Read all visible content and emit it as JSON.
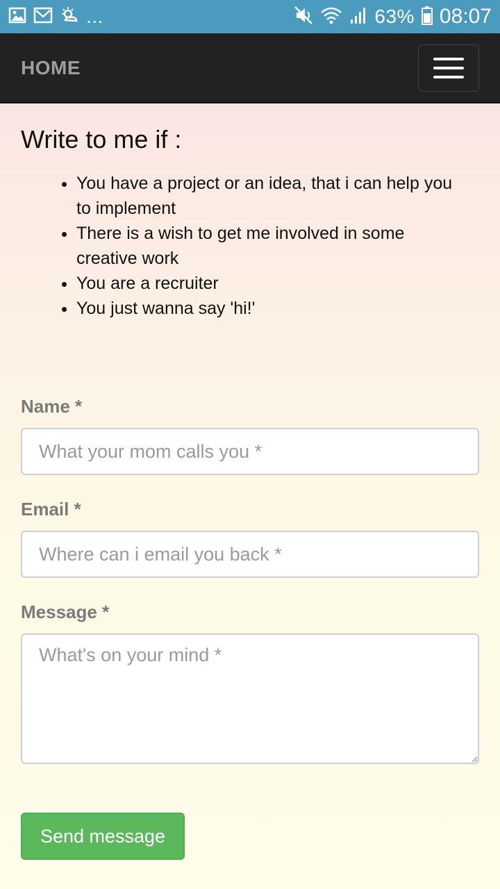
{
  "status_bar": {
    "battery": "63%",
    "time": "08:07",
    "more_indicator": "...",
    "icons": [
      "image-icon",
      "mail-icon",
      "weather-icon",
      "mute-icon",
      "wifi-icon",
      "signal-icon",
      "battery-icon"
    ]
  },
  "navbar": {
    "brand": "HOME",
    "menu_icon": "hamburger-menu-icon"
  },
  "intro": {
    "heading": "Write to me if :",
    "reasons": [
      "You have a project or an idea, that i can help you to implement",
      "There is a wish to get me involved in some creative work",
      "You are a recruiter",
      "You just wanna say 'hi!'"
    ]
  },
  "form": {
    "name_label": "Name *",
    "name_placeholder": "What your mom calls you *",
    "email_label": "Email *",
    "email_placeholder": "Where can i email you back *",
    "message_label": "Message *",
    "message_placeholder": "What's on your mind *",
    "submit_label": "Send message"
  },
  "colors": {
    "status_bar": "#4a9bbd",
    "navbar": "#222222",
    "submit_button": "#5cb85c"
  }
}
